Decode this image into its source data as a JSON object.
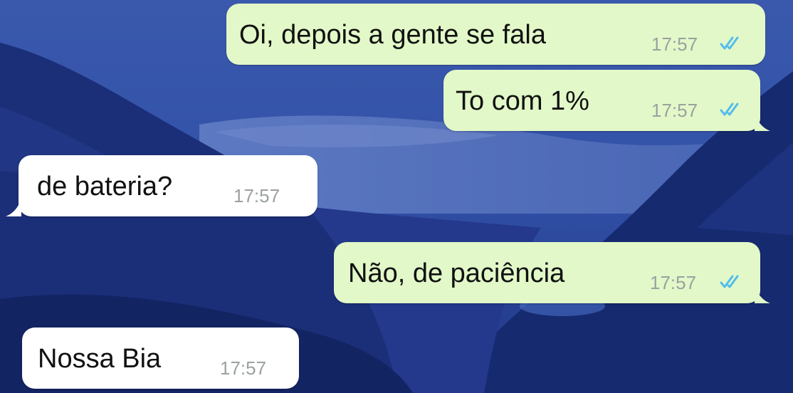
{
  "chat": {
    "messages": [
      {
        "direction": "outgoing",
        "text": "Oi, depois a gente se fala",
        "time": "17:57",
        "status": "read-double-check-icon"
      },
      {
        "direction": "outgoing",
        "text": "To com 1%",
        "time": "17:57",
        "status": "read-double-check-icon"
      },
      {
        "direction": "incoming",
        "text": "de bateria?",
        "time": "17:57"
      },
      {
        "direction": "outgoing",
        "text": "Não, de paciência",
        "time": "17:57",
        "status": "read-double-check-icon"
      },
      {
        "direction": "incoming",
        "text": "Nossa Bia",
        "time": "17:57"
      }
    ]
  },
  "colors": {
    "outgoing_bubble": "#e2f8c8",
    "incoming_bubble": "#ffffff",
    "read_ticks": "#53bdeb",
    "wallpaper_sky": "#2d4a9c",
    "wallpaper_mountains": "#16286b"
  }
}
